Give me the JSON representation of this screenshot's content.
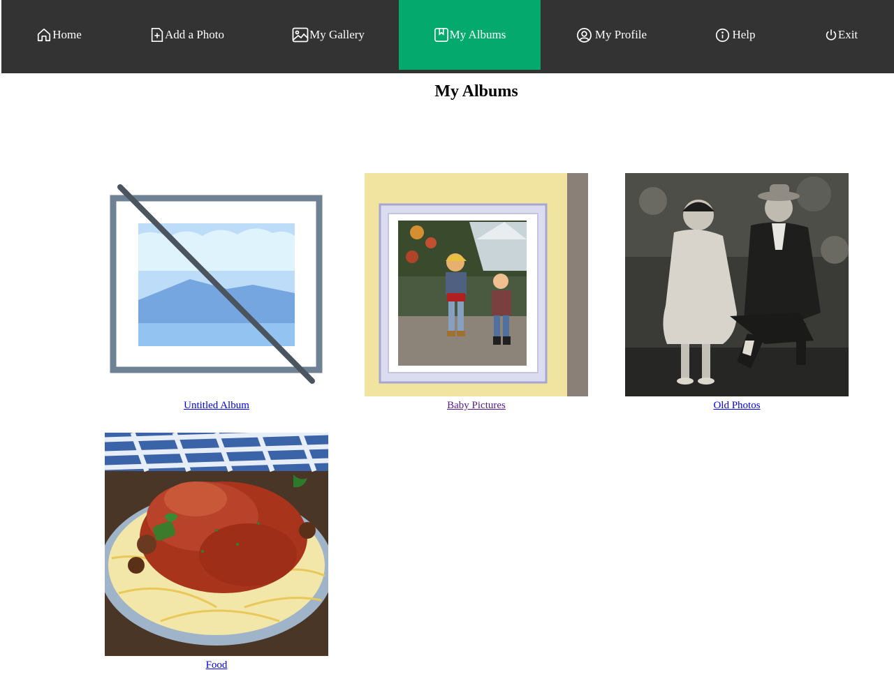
{
  "nav": {
    "items": [
      {
        "label": "Home",
        "icon": "home-icon"
      },
      {
        "label": "Add a Photo",
        "icon": "add-photo-icon"
      },
      {
        "label": "My Gallery",
        "icon": "image-icon"
      },
      {
        "label": "My Albums",
        "icon": "bookmark-icon"
      },
      {
        "label": "My Profile",
        "icon": "user-circle-icon"
      },
      {
        "label": "Help",
        "icon": "info-icon"
      },
      {
        "label": "Exit",
        "icon": "power-icon"
      }
    ],
    "active": "My Albums",
    "colors": {
      "bar": "#333333",
      "active": "#04aa6d",
      "text": "#ffffff"
    }
  },
  "page": {
    "title": "My Albums"
  },
  "albums": [
    {
      "name": "Untitled Album",
      "thumbnail": "broken-image-placeholder"
    },
    {
      "name": "Baby Pictures",
      "thumbnail": "framed-photo-of-two-toddlers"
    },
    {
      "name": "Old Photos",
      "thumbnail": "black-and-white-couple-portrait"
    },
    {
      "name": "Food",
      "thumbnail": "chicken-cacciatore-on-spaghetti"
    }
  ],
  "colors": {
    "link": "#0000ee",
    "visited_link": "#551a8b"
  }
}
